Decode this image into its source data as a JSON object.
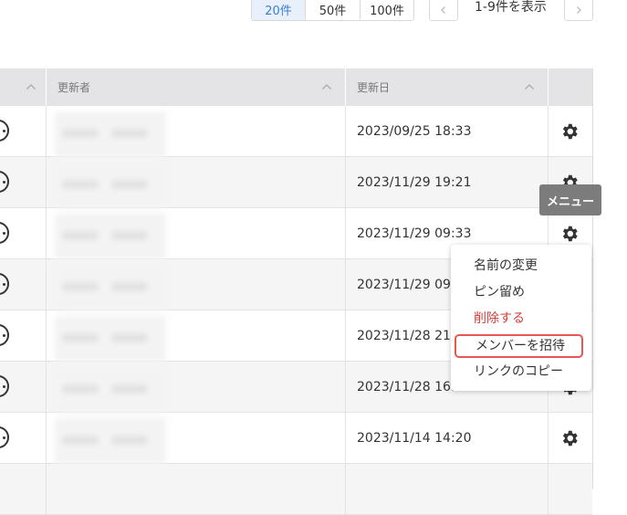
{
  "pagination": {
    "page_sizes": [
      "20件",
      "50件",
      "100件"
    ],
    "active_page_size": "20件",
    "range_text": "1-9件を表示"
  },
  "table": {
    "columns": [
      "更新者",
      "更新日"
    ],
    "rows": [
      {
        "updated_at": "2023/09/25 18:33"
      },
      {
        "updated_at": "2023/11/29 19:21"
      },
      {
        "updated_at": "2023/11/29 09:33"
      },
      {
        "updated_at": "2023/11/29 09:"
      },
      {
        "updated_at": "2023/11/28 21:"
      },
      {
        "updated_at": "2023/11/28 16:"
      },
      {
        "updated_at": "2023/11/14 14:20"
      }
    ]
  },
  "tooltip": {
    "text": "メニュー"
  },
  "context_menu": {
    "items": [
      "名前の変更",
      "ピン留め",
      "削除する",
      "メンバーを招待",
      "リンクのコピー"
    ],
    "highlighted": "メンバーを招待",
    "danger_color": "#d0403a"
  },
  "colors": {
    "accent": "#3b7ed6",
    "header_bg": "#e4e4e7",
    "highlight_border": "#e5574f"
  }
}
